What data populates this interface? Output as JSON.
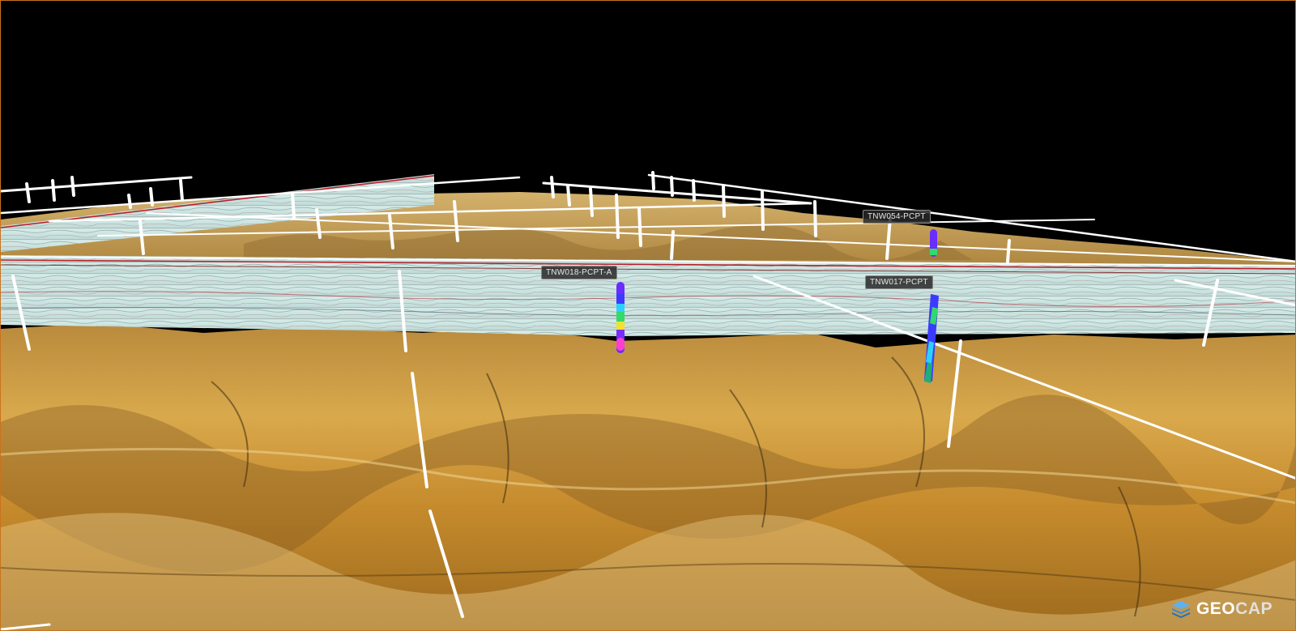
{
  "app": {
    "brand_part1": "GEO",
    "brand_part2": "CAP",
    "logo_icon": "stacked-layers-icon"
  },
  "wells": [
    {
      "name": "TNW054-PCPT"
    },
    {
      "name": "TNW018-PCPT-A"
    },
    {
      "name": "TNW017-PCPT"
    }
  ],
  "colors": {
    "background": "#000000",
    "viewport_border": "#c9731d",
    "terrain_light": "#e7c27a",
    "terrain_mid": "#c9922f",
    "terrain_dark": "#5a4420",
    "seismic_base": "#cfe7e4",
    "seismic_reflector": "#b8202a",
    "survey_line": "#ffffff",
    "log_colors": [
      "#7b2cff",
      "#3b3bff",
      "#2bd0ff",
      "#33d96b",
      "#f2e230",
      "#ff3fd0"
    ],
    "logo_blue": "#2a8de0"
  }
}
